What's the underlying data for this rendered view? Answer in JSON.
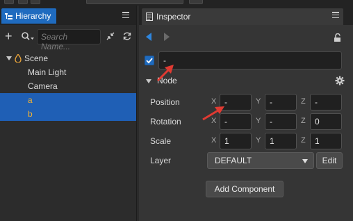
{
  "colors": {
    "accent": "#1f6bbf",
    "selection": "#1f5fb5",
    "selected_text": "#f2b233",
    "annotation_arrow": "#e03a32"
  },
  "hierarchy": {
    "tab_label": "Hierarchy",
    "search_placeholder": "Search Name...",
    "items": [
      {
        "label": "Scene",
        "icon": "scene-icon",
        "expanded": true,
        "selected": false
      },
      {
        "label": "Main Light",
        "selected": false
      },
      {
        "label": "Camera",
        "selected": false
      },
      {
        "label": "a",
        "selected": true
      },
      {
        "label": "b",
        "selected": true
      }
    ]
  },
  "inspector": {
    "tab_label": "Inspector",
    "node_name": "-",
    "section_label": "Node",
    "position": {
      "label": "Position",
      "x_axis": "X",
      "y_axis": "Y",
      "z_axis": "Z",
      "x": "-",
      "y": "-",
      "z": "-"
    },
    "rotation": {
      "label": "Rotation",
      "x_axis": "X",
      "y_axis": "Y",
      "z_axis": "Z",
      "x": "-",
      "y": "-",
      "z": "0"
    },
    "scale": {
      "label": "Scale",
      "x_axis": "X",
      "y_axis": "Y",
      "z_axis": "Z",
      "x": "1",
      "y": "1",
      "z": "1"
    },
    "layer": {
      "label": "Layer",
      "value": "DEFAULT",
      "edit_label": "Edit"
    },
    "add_component_label": "Add Component"
  }
}
